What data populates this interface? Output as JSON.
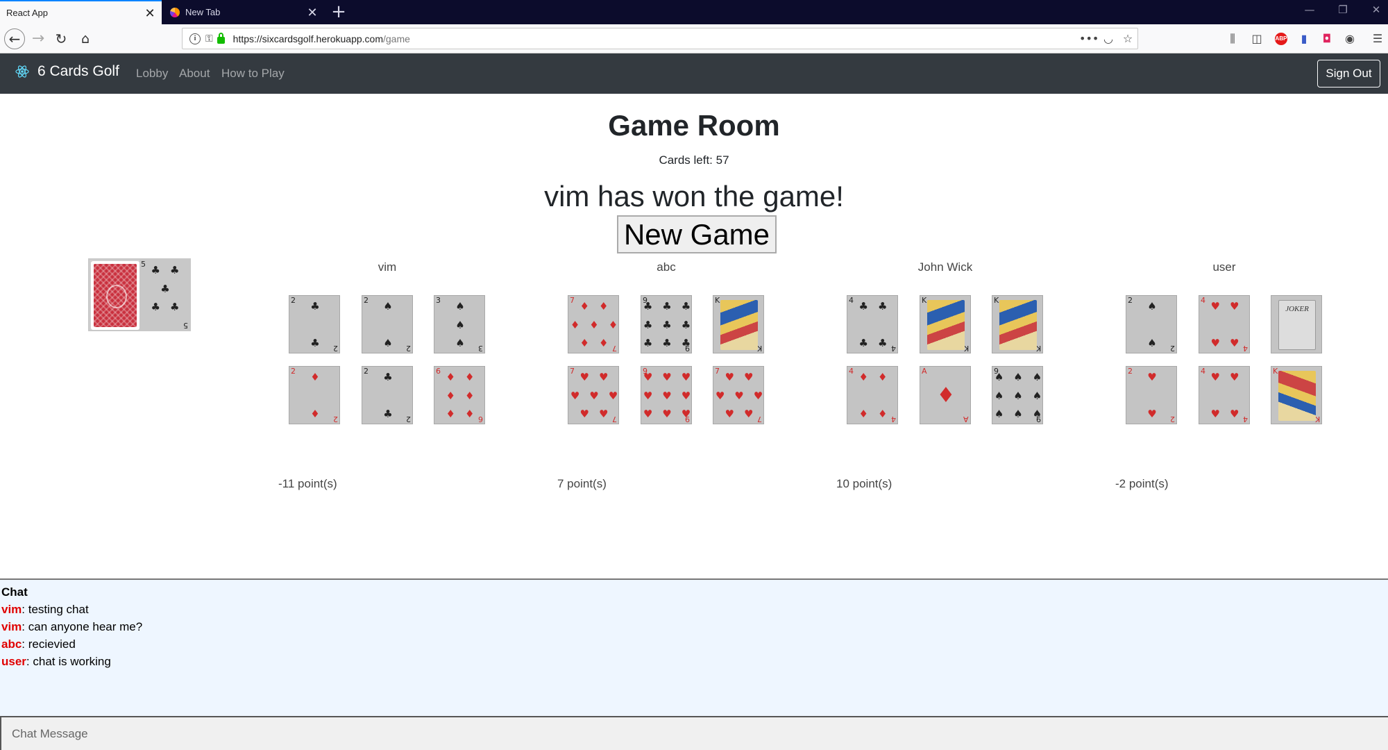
{
  "browser": {
    "tabs": [
      {
        "label": "React App",
        "close": "✕"
      },
      {
        "label": "New Tab",
        "close": "✕"
      }
    ],
    "new_tab": "+",
    "url_domain": "https://sixcardsgolf.herokuapp.com",
    "url_path": "/game",
    "win_min": "—",
    "win_restore": "❐",
    "win_close": "✕"
  },
  "app": {
    "brand": "6 Cards Golf",
    "nav": {
      "lobby": "Lobby",
      "about": "About",
      "howto": "How to Play"
    },
    "sign_out": "Sign Out"
  },
  "game": {
    "title": "Game Room",
    "cards_left": "Cards left: 57",
    "winner_message": "vim has won the game!",
    "new_game_label": "New Game",
    "discard_top": {
      "rank": "5",
      "suit": "♣",
      "color": "black"
    },
    "players": [
      {
        "name": "vim",
        "points": "-11 point(s)",
        "cards": [
          {
            "rank": "2",
            "suit": "♣",
            "color": "black"
          },
          {
            "rank": "2",
            "suit": "♠",
            "color": "black"
          },
          {
            "rank": "3",
            "suit": "♠",
            "color": "black"
          },
          {
            "rank": "2",
            "suit": "♦",
            "color": "red"
          },
          {
            "rank": "2",
            "suit": "♣",
            "color": "black"
          },
          {
            "rank": "6",
            "suit": "♦",
            "color": "red"
          }
        ]
      },
      {
        "name": "abc",
        "points": "7 point(s)",
        "cards": [
          {
            "rank": "7",
            "suit": "♦",
            "color": "red"
          },
          {
            "rank": "9",
            "suit": "♣",
            "color": "black"
          },
          {
            "rank": "K",
            "suit": "♣",
            "color": "black"
          },
          {
            "rank": "7",
            "suit": "♥",
            "color": "red"
          },
          {
            "rank": "9",
            "suit": "♥",
            "color": "red"
          },
          {
            "rank": "7",
            "suit": "♥",
            "color": "red"
          }
        ]
      },
      {
        "name": "John Wick",
        "points": "10 point(s)",
        "cards": [
          {
            "rank": "4",
            "suit": "♣",
            "color": "black"
          },
          {
            "rank": "K",
            "suit": "♠",
            "color": "black"
          },
          {
            "rank": "K",
            "suit": "♣",
            "color": "black"
          },
          {
            "rank": "4",
            "suit": "♦",
            "color": "red"
          },
          {
            "rank": "A",
            "suit": "♦",
            "color": "red"
          },
          {
            "rank": "9",
            "suit": "♠",
            "color": "black"
          }
        ]
      },
      {
        "name": "user",
        "points": "-2 point(s)",
        "cards": [
          {
            "rank": "2",
            "suit": "♠",
            "color": "black"
          },
          {
            "rank": "4",
            "suit": "♥",
            "color": "red"
          },
          {
            "rank": "JOKER",
            "suit": "",
            "color": "black"
          },
          {
            "rank": "2",
            "suit": "♥",
            "color": "red"
          },
          {
            "rank": "4",
            "suit": "♥",
            "color": "red"
          },
          {
            "rank": "K",
            "suit": "♥",
            "color": "red"
          }
        ]
      }
    ]
  },
  "chat": {
    "title": "Chat",
    "messages": [
      {
        "user": "vim",
        "text": ": testing chat"
      },
      {
        "user": "vim",
        "text": ": can anyone hear me?"
      },
      {
        "user": "abc",
        "text": ": recievied"
      },
      {
        "user": "user",
        "text": ": chat is working"
      }
    ],
    "input_placeholder": "Chat Message"
  },
  "colors": {
    "navbar": "#343a40",
    "chat_bg": "#eef6ff",
    "chat_user": "#e00000",
    "card_red": "#d12b2b"
  }
}
